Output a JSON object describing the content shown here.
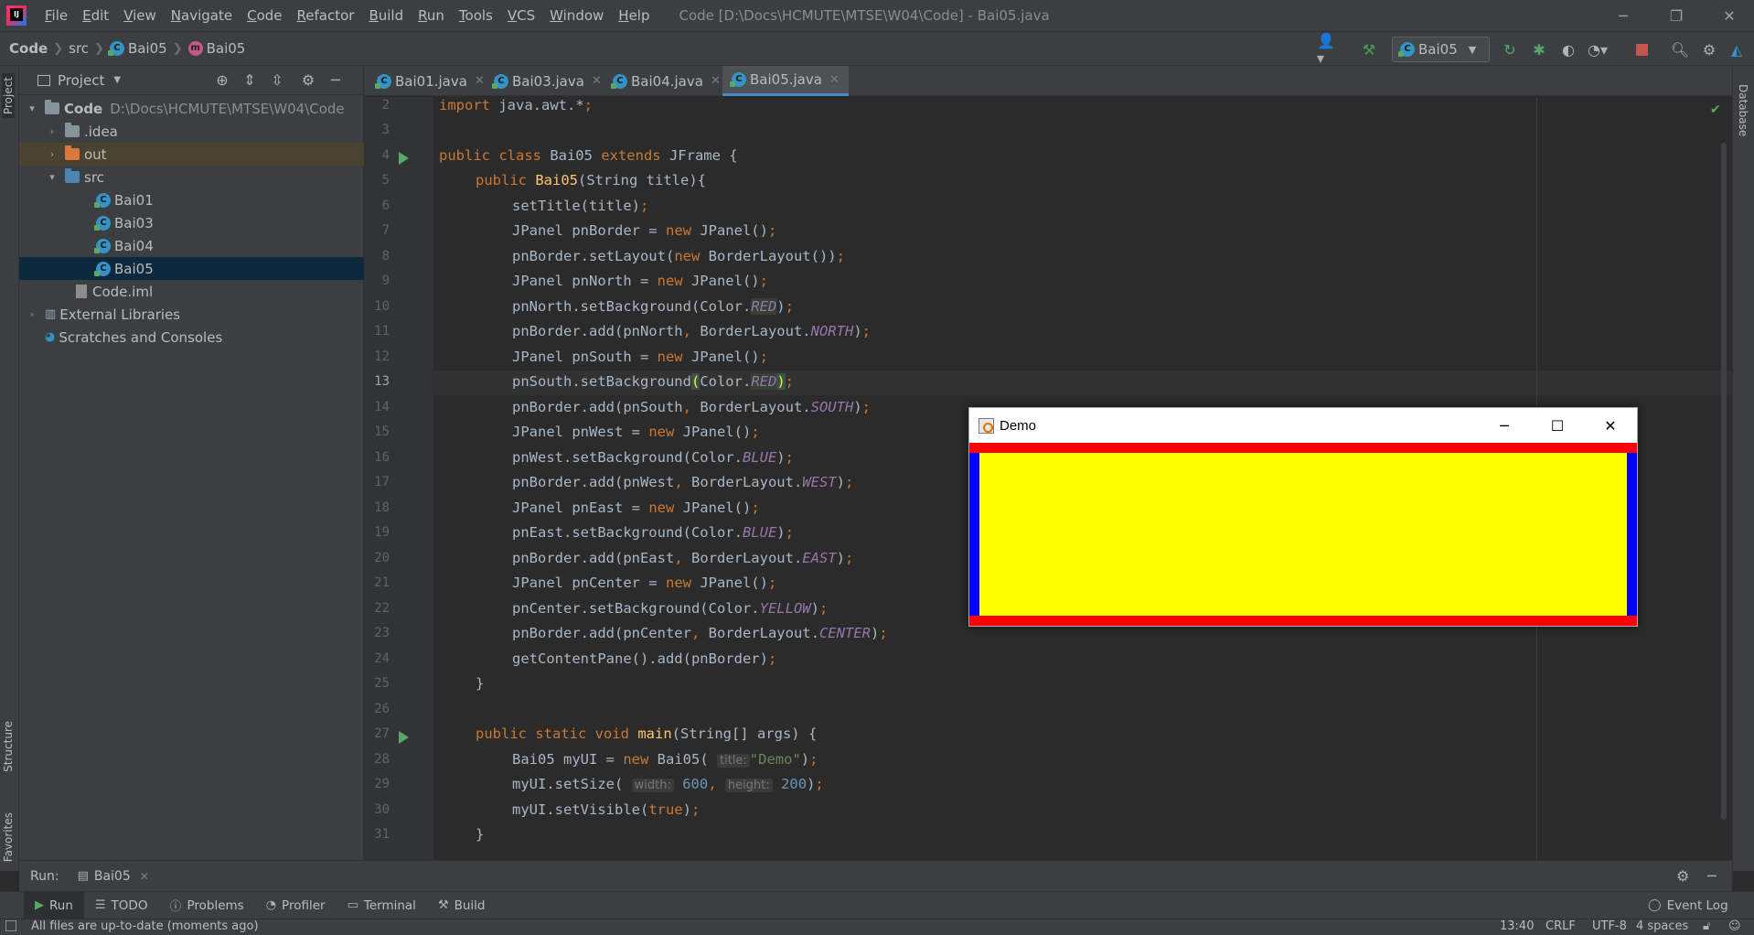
{
  "titlebar": {
    "menus": [
      "File",
      "Edit",
      "View",
      "Navigate",
      "Code",
      "Refactor",
      "Build",
      "Run",
      "Tools",
      "VCS",
      "Window",
      "Help"
    ],
    "window_title": "Code [D:\\Docs\\HCMUTE\\MTSE\\W04\\Code] - Bai05.java",
    "controls": {
      "minimize": "─",
      "restore": "❐",
      "close": "✕"
    }
  },
  "navbar": {
    "crumbs": [
      "Code",
      "src",
      "Bai05",
      "Bai05"
    ],
    "run_config": "Bai05",
    "colors": {
      "run": "#59a869",
      "stop": "#c75450",
      "build": "#499c54"
    }
  },
  "left_strip": {
    "tabs": [
      "Project",
      "Structure",
      "Favorites"
    ]
  },
  "right_strip": {
    "tabs": [
      "Database"
    ]
  },
  "project": {
    "header": "Project",
    "tree": [
      {
        "label": "Code",
        "extra": "D:\\Docs\\HCMUTE\\MTSE\\W04\\Code",
        "kind": "module",
        "arrow": "▾"
      },
      {
        "label": ".idea",
        "kind": "folder",
        "arrow": "›"
      },
      {
        "label": "out",
        "kind": "folder-excluded",
        "arrow": "›"
      },
      {
        "label": "src",
        "kind": "folder-src",
        "arrow": "▾"
      },
      {
        "label": "Bai01",
        "kind": "class"
      },
      {
        "label": "Bai03",
        "kind": "class"
      },
      {
        "label": "Bai04",
        "kind": "class"
      },
      {
        "label": "Bai05",
        "kind": "class",
        "selected": true
      },
      {
        "label": "Code.iml",
        "kind": "file"
      },
      {
        "label": "External Libraries",
        "kind": "libs",
        "arrow": "›"
      },
      {
        "label": "Scratches and Consoles",
        "kind": "scratch"
      }
    ]
  },
  "editor": {
    "tabs": [
      {
        "label": "Bai01.java",
        "active": false
      },
      {
        "label": "Bai03.java",
        "active": false
      },
      {
        "label": "Bai04.java",
        "active": false
      },
      {
        "label": "Bai05.java",
        "active": true
      }
    ],
    "line_numbers": [
      "2",
      "3",
      "4",
      "5",
      "6",
      "7",
      "8",
      "9",
      "10",
      "11",
      "12",
      "13",
      "14",
      "15",
      "16",
      "17",
      "18",
      "19",
      "20",
      "21",
      "22",
      "23",
      "24",
      "25",
      "26",
      "27",
      "28",
      "29",
      "30",
      "31"
    ],
    "current_line": "13"
  },
  "demo_window": {
    "title": "Demo",
    "controls": {
      "minimize": "─",
      "maximize": "☐",
      "close": "✕"
    },
    "colors": {
      "north": "#ff0000",
      "south": "#ff0000",
      "west": "#0000ff",
      "east": "#0000ff",
      "center": "#ffff00"
    }
  },
  "run_bar": {
    "label": "Run:",
    "tab": "Bai05"
  },
  "tool_windows": [
    {
      "label": "Run",
      "icon": "run-icon",
      "active": true
    },
    {
      "label": "TODO",
      "icon": "todo-icon"
    },
    {
      "label": "Problems",
      "icon": "problems-icon"
    },
    {
      "label": "Profiler",
      "icon": "profiler-icon"
    },
    {
      "label": "Terminal",
      "icon": "terminal-icon"
    },
    {
      "label": "Build",
      "icon": "build-icon"
    }
  ],
  "event_log": "Event Log",
  "status": {
    "message": "All files are up-to-date (moments ago)",
    "position": "13:40",
    "line_sep": "CRLF",
    "encoding": "UTF-8",
    "indent": "4 spaces"
  }
}
